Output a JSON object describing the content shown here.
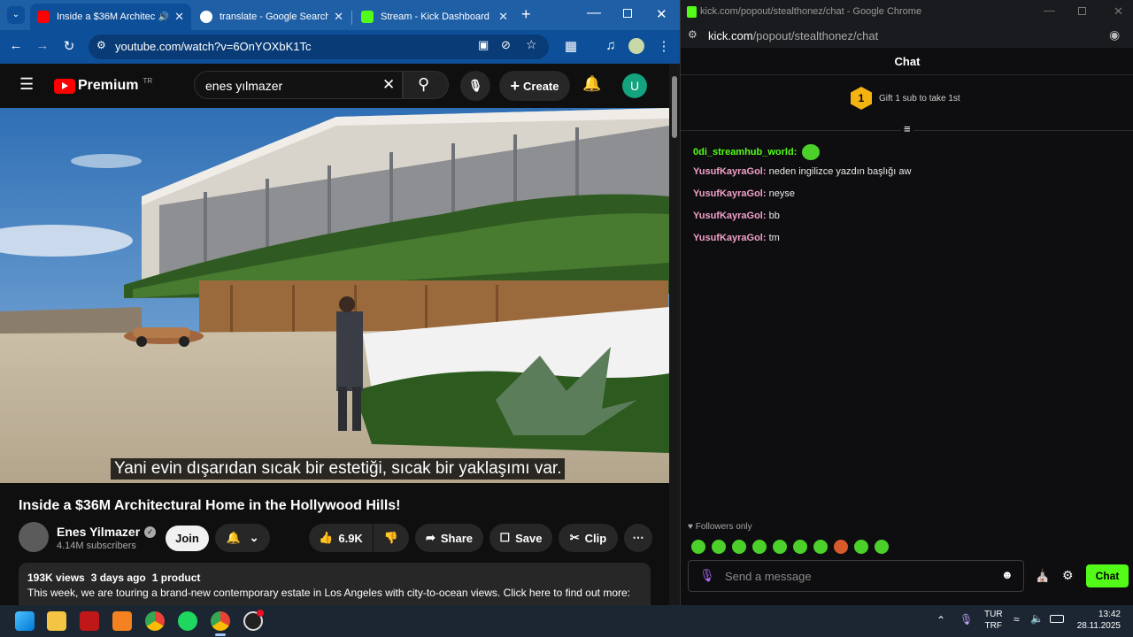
{
  "browser_tabs": [
    {
      "title": "Inside a $36M Architectu",
      "active": true
    },
    {
      "title": "translate - Google Search",
      "active": false
    },
    {
      "title": "Stream - Kick Dashboard",
      "active": false
    }
  ],
  "address_bar": {
    "url": "youtube.com/watch?v=6OnYOXbK1Tc"
  },
  "youtube": {
    "logo": "Premium",
    "country_code": "TR",
    "search_value": "enes yılmazer",
    "create_label": "Create",
    "avatar_letter": "U",
    "subtitle": "Yani evin dışarıdan sıcak bir estetiği, sıcak bir yaklaşımı var.",
    "video_title": "Inside a $36M Architectural Home in the Hollywood Hills!",
    "channel_name": "Enes Yilmazer",
    "subscribers": "4.14M subscribers",
    "join_label": "Join",
    "likes": "6.9K",
    "share_label": "Share",
    "save_label": "Save",
    "clip_label": "Clip",
    "views": "193K views",
    "age": "3 days ago",
    "products": "1 product",
    "description": "This week, we are touring a brand-new contemporary estate in Los Angeles with city-to-ocean views. Click here to find out more:"
  },
  "kick": {
    "window_title": "kick.com/popout/stealthonez/chat - Google Chrome",
    "url_host": "kick.com",
    "url_path": "/popout/stealthonez/chat",
    "chat_title": "Chat",
    "gift_rank": "1",
    "gift_text": "Gift 1 sub to take 1st",
    "messages": [
      {
        "user": "0di_streamhub_world:",
        "text": ""
      },
      {
        "user": "YusufKayraGol:",
        "text": "neden ingilizce yazdın başlığı aw"
      },
      {
        "user": "YusufKayraGol:",
        "text": "neyse"
      },
      {
        "user": "YusufKayraGol:",
        "text": "bb"
      },
      {
        "user": "YusufKayraGol:",
        "text": "tm"
      }
    ],
    "followers_only": "Followers only",
    "message_placeholder": "Send a message",
    "chat_button": "Chat"
  },
  "taskbar": {
    "lang_top": "TUR",
    "lang_bottom": "TRF",
    "time": "13:42",
    "date": "28.11.2025"
  },
  "colors": {
    "kick_green": "#53fc18",
    "chrome_blue": "#1e5fa6",
    "yt_red": "#ff0000"
  }
}
